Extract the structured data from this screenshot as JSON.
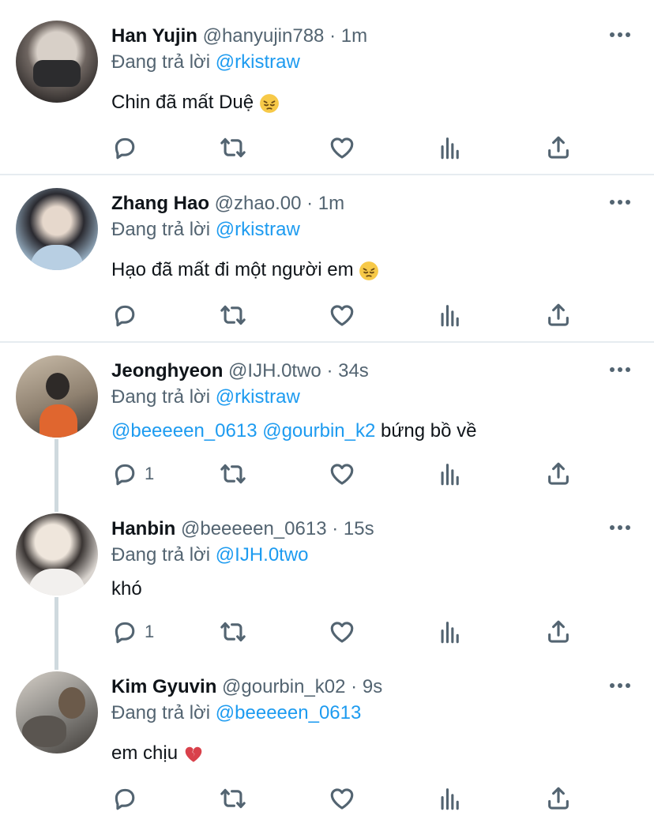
{
  "reply_prefix": "Đang trả lời",
  "tweets": [
    {
      "name": "Han Yujin",
      "handle": "@hanyujin788",
      "dot": "·",
      "time": "1m",
      "reply_to": "@rkistraw",
      "text": "Chin đã mất Duệ",
      "emoji": "pensive-face",
      "reply_count": "",
      "avatar_colors": [
        "#cfc8c2",
        "#4a4442"
      ]
    },
    {
      "name": "Zhang Hao",
      "handle": "@zhao.00",
      "dot": "·",
      "time": "1m",
      "reply_to": "@rkistraw",
      "text": "Hạo đã mất đi một người em",
      "emoji": "pensive-face",
      "reply_count": "",
      "avatar_colors": [
        "#9bb4c8",
        "#2a2a30"
      ]
    },
    {
      "name": "Jeonghyeon",
      "handle": "@IJH.0two",
      "dot": "·",
      "time": "34s",
      "reply_to": "@rkistraw",
      "mentions": [
        "@beeeeen_0613",
        "@gourbin_k2"
      ],
      "text": "bứng bồ về",
      "reply_count": "1",
      "avatar_colors": [
        "#b8a996",
        "#e0662f"
      ]
    },
    {
      "name": "Hanbin",
      "handle": "@beeeeen_0613",
      "dot": "·",
      "time": "15s",
      "reply_to": "@IJH.0two",
      "text": "khó",
      "reply_count": "1",
      "avatar_colors": [
        "#d9d4cf",
        "#3a3533"
      ]
    },
    {
      "name": "Kim Gyuvin",
      "handle": "@gourbin_k02",
      "dot": "·",
      "time": "9s",
      "reply_to": "@beeeeen_0613",
      "text": "em chịu",
      "emoji": "broken-heart",
      "reply_count": "",
      "avatar_colors": [
        "#8c8a86",
        "#3d3935"
      ]
    }
  ],
  "colors": {
    "link": "#1d9bf0",
    "secondary": "#536471",
    "primary": "#0f1419",
    "separator": "#e6ecf0"
  },
  "icons": [
    "reply-icon",
    "retweet-icon",
    "like-icon",
    "analytics-icon",
    "share-icon",
    "more-icon"
  ]
}
